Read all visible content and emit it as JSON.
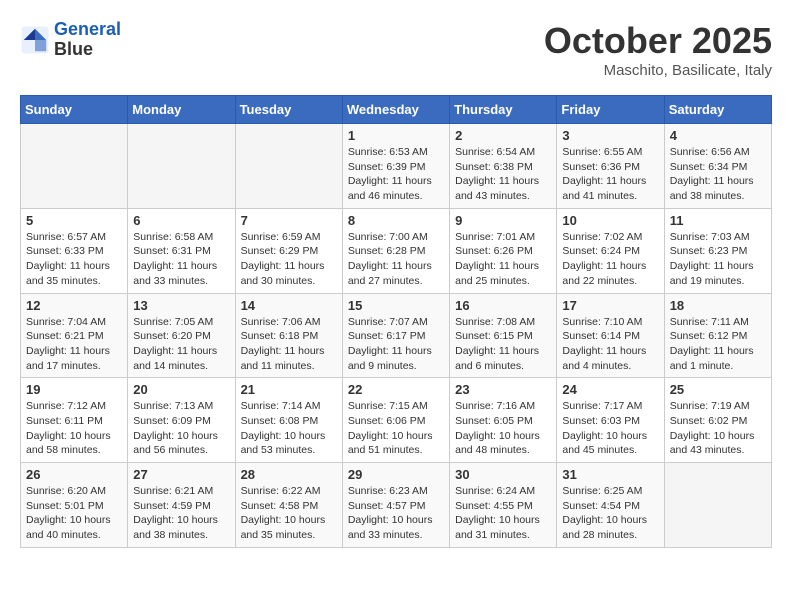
{
  "header": {
    "logo_line1": "General",
    "logo_line2": "Blue",
    "month": "October 2025",
    "location": "Maschito, Basilicate, Italy"
  },
  "weekdays": [
    "Sunday",
    "Monday",
    "Tuesday",
    "Wednesday",
    "Thursday",
    "Friday",
    "Saturday"
  ],
  "weeks": [
    [
      {
        "day": "",
        "info": ""
      },
      {
        "day": "",
        "info": ""
      },
      {
        "day": "",
        "info": ""
      },
      {
        "day": "1",
        "info": "Sunrise: 6:53 AM\nSunset: 6:39 PM\nDaylight: 11 hours and 46 minutes."
      },
      {
        "day": "2",
        "info": "Sunrise: 6:54 AM\nSunset: 6:38 PM\nDaylight: 11 hours and 43 minutes."
      },
      {
        "day": "3",
        "info": "Sunrise: 6:55 AM\nSunset: 6:36 PM\nDaylight: 11 hours and 41 minutes."
      },
      {
        "day": "4",
        "info": "Sunrise: 6:56 AM\nSunset: 6:34 PM\nDaylight: 11 hours and 38 minutes."
      }
    ],
    [
      {
        "day": "5",
        "info": "Sunrise: 6:57 AM\nSunset: 6:33 PM\nDaylight: 11 hours and 35 minutes."
      },
      {
        "day": "6",
        "info": "Sunrise: 6:58 AM\nSunset: 6:31 PM\nDaylight: 11 hours and 33 minutes."
      },
      {
        "day": "7",
        "info": "Sunrise: 6:59 AM\nSunset: 6:29 PM\nDaylight: 11 hours and 30 minutes."
      },
      {
        "day": "8",
        "info": "Sunrise: 7:00 AM\nSunset: 6:28 PM\nDaylight: 11 hours and 27 minutes."
      },
      {
        "day": "9",
        "info": "Sunrise: 7:01 AM\nSunset: 6:26 PM\nDaylight: 11 hours and 25 minutes."
      },
      {
        "day": "10",
        "info": "Sunrise: 7:02 AM\nSunset: 6:24 PM\nDaylight: 11 hours and 22 minutes."
      },
      {
        "day": "11",
        "info": "Sunrise: 7:03 AM\nSunset: 6:23 PM\nDaylight: 11 hours and 19 minutes."
      }
    ],
    [
      {
        "day": "12",
        "info": "Sunrise: 7:04 AM\nSunset: 6:21 PM\nDaylight: 11 hours and 17 minutes."
      },
      {
        "day": "13",
        "info": "Sunrise: 7:05 AM\nSunset: 6:20 PM\nDaylight: 11 hours and 14 minutes."
      },
      {
        "day": "14",
        "info": "Sunrise: 7:06 AM\nSunset: 6:18 PM\nDaylight: 11 hours and 11 minutes."
      },
      {
        "day": "15",
        "info": "Sunrise: 7:07 AM\nSunset: 6:17 PM\nDaylight: 11 hours and 9 minutes."
      },
      {
        "day": "16",
        "info": "Sunrise: 7:08 AM\nSunset: 6:15 PM\nDaylight: 11 hours and 6 minutes."
      },
      {
        "day": "17",
        "info": "Sunrise: 7:10 AM\nSunset: 6:14 PM\nDaylight: 11 hours and 4 minutes."
      },
      {
        "day": "18",
        "info": "Sunrise: 7:11 AM\nSunset: 6:12 PM\nDaylight: 11 hours and 1 minute."
      }
    ],
    [
      {
        "day": "19",
        "info": "Sunrise: 7:12 AM\nSunset: 6:11 PM\nDaylight: 10 hours and 58 minutes."
      },
      {
        "day": "20",
        "info": "Sunrise: 7:13 AM\nSunset: 6:09 PM\nDaylight: 10 hours and 56 minutes."
      },
      {
        "day": "21",
        "info": "Sunrise: 7:14 AM\nSunset: 6:08 PM\nDaylight: 10 hours and 53 minutes."
      },
      {
        "day": "22",
        "info": "Sunrise: 7:15 AM\nSunset: 6:06 PM\nDaylight: 10 hours and 51 minutes."
      },
      {
        "day": "23",
        "info": "Sunrise: 7:16 AM\nSunset: 6:05 PM\nDaylight: 10 hours and 48 minutes."
      },
      {
        "day": "24",
        "info": "Sunrise: 7:17 AM\nSunset: 6:03 PM\nDaylight: 10 hours and 45 minutes."
      },
      {
        "day": "25",
        "info": "Sunrise: 7:19 AM\nSunset: 6:02 PM\nDaylight: 10 hours and 43 minutes."
      }
    ],
    [
      {
        "day": "26",
        "info": "Sunrise: 6:20 AM\nSunset: 5:01 PM\nDaylight: 10 hours and 40 minutes."
      },
      {
        "day": "27",
        "info": "Sunrise: 6:21 AM\nSunset: 4:59 PM\nDaylight: 10 hours and 38 minutes."
      },
      {
        "day": "28",
        "info": "Sunrise: 6:22 AM\nSunset: 4:58 PM\nDaylight: 10 hours and 35 minutes."
      },
      {
        "day": "29",
        "info": "Sunrise: 6:23 AM\nSunset: 4:57 PM\nDaylight: 10 hours and 33 minutes."
      },
      {
        "day": "30",
        "info": "Sunrise: 6:24 AM\nSunset: 4:55 PM\nDaylight: 10 hours and 31 minutes."
      },
      {
        "day": "31",
        "info": "Sunrise: 6:25 AM\nSunset: 4:54 PM\nDaylight: 10 hours and 28 minutes."
      },
      {
        "day": "",
        "info": ""
      }
    ]
  ]
}
